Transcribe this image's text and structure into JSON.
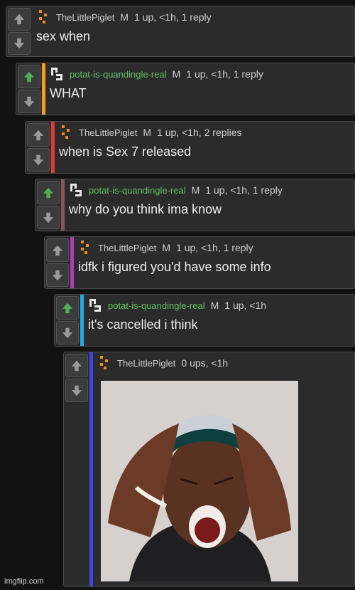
{
  "comments": [
    {
      "username": "TheLittlePiglet",
      "mod": "M",
      "stats": "1 up, <1h, 1 reply",
      "text": "sex when"
    },
    {
      "username": "potat-is-quandingle-real",
      "mod": "M",
      "stats": "1 up, <1h, 1 reply",
      "text": "WHAT"
    },
    {
      "username": "TheLittlePiglet",
      "mod": "M",
      "stats": "1 up, <1h, 2 replies",
      "text": "when is Sex 7 released"
    },
    {
      "username": "potat-is-quandingle-real",
      "mod": "M",
      "stats": "1 up, <1h, 1 reply",
      "text": "why do you think ima know"
    },
    {
      "username": "TheLittlePiglet",
      "mod": "M",
      "stats": "1 up, <1h, 1 reply",
      "text": "idfk i figured you'd have some info"
    },
    {
      "username": "potat-is-quandingle-real",
      "mod": "M",
      "stats": "1 up, <1h",
      "text": "it's cancelled i think"
    },
    {
      "username": "TheLittlePiglet",
      "mod": "",
      "stats": "0 ups, <1h",
      "text": ""
    }
  ],
  "watermark": "imgflip.com",
  "colors": {
    "thread_bars": [
      "#f0a020",
      "#e03b2f",
      "#8a5555",
      "#b03ab8",
      "#25a8e0",
      "#3c46e8"
    ],
    "upvote_active": "#4caf50",
    "potat_name": "#5fc15f"
  }
}
